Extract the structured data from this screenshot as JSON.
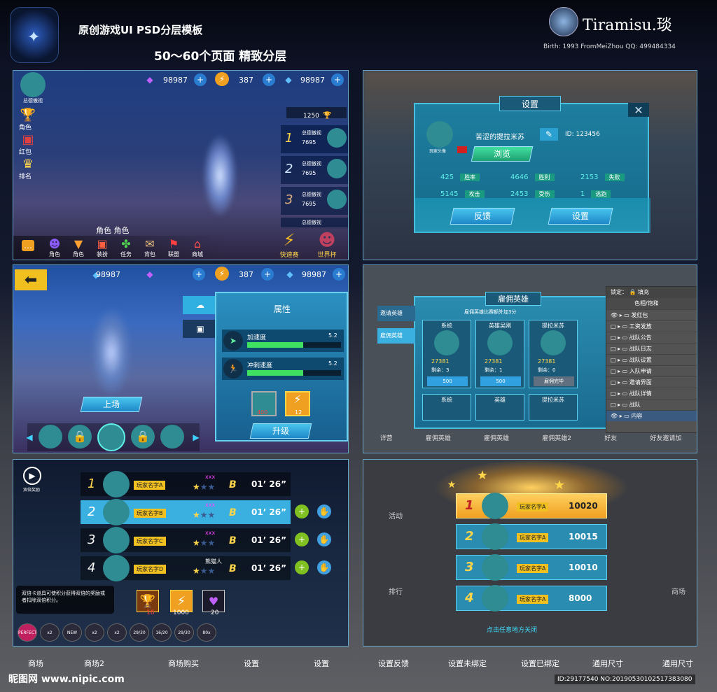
{
  "header": {
    "title": "原创游戏UI PSD分层模板",
    "subtitle": "50～60个页面 精致分层",
    "brand": "Tiramisu.琰",
    "brand_info": "Birth: 1993 FromMeiZhou QQ: 499484334"
  },
  "p1": {
    "badge_small": "总德傲视",
    "res1": "98987",
    "res2": "387",
    "res3": "98987",
    "score": "1250",
    "rank_name1": "总德傲视",
    "rank_val1": "7695",
    "rank_name2": "总德傲视",
    "rank_val2": "7695",
    "rank_name3": "总德傲视",
    "rank_val3": "7695",
    "rank_name4": "总德傲视",
    "left_labels": [
      "角色",
      "红包",
      "排名"
    ],
    "char_title": "角色 角色",
    "bottom": [
      "角色",
      "角色",
      "装扮",
      "任务",
      "背包",
      "联盟",
      "商城"
    ],
    "right_btns": [
      "快速赛",
      "世界杯"
    ],
    "nums": [
      "1",
      "2",
      "3"
    ]
  },
  "p2": {
    "title": "设置",
    "name": "苦涩的提拉米苏",
    "id": "ID: 123456",
    "avatar_lbl": "玩家头像",
    "browse": "浏览",
    "stats": [
      {
        "v": "425",
        "l": "胜率"
      },
      {
        "v": "4646",
        "l": "胜利"
      },
      {
        "v": "2153",
        "l": "失败"
      },
      {
        "v": "5145",
        "l": "攻击"
      },
      {
        "v": "2453",
        "l": "受伤"
      },
      {
        "v": "1",
        "l": "逃跑"
      }
    ],
    "feedback": "反馈",
    "settings": "设置"
  },
  "p3": {
    "res1": "98987",
    "res2": "387",
    "res3": "98987",
    "attr_title": "属性",
    "speed": "加速度",
    "speed_val": "5.2",
    "dash": "冲刺速度",
    "dash_val": "5.2",
    "cost1": "400",
    "cost2": "12",
    "upgrade": "升级",
    "deploy": "上场"
  },
  "p4": {
    "title": "雇佣英雄",
    "subtitle": "雇佣英雄比赛额外加3分",
    "tabs": [
      "邀请英雄",
      "雇佣英雄"
    ],
    "cards": [
      {
        "n": "系统",
        "v": "27381",
        "r": "剩余：3",
        "b": "500"
      },
      {
        "n": "英雄吴刚",
        "v": "27381",
        "r": "剩余：1",
        "b": "500"
      },
      {
        "n": "提拉米苏",
        "v": "27381",
        "r": "剩余：0",
        "b": "雇佣完毕"
      }
    ],
    "row2": [
      "系统",
      "英雄",
      "提拉米苏"
    ],
    "remain": "剩余",
    "layers_title": "锁定：",
    "layers_fill": "填充",
    "layers_top": "色相/饱和",
    "layers": [
      "发红包",
      "工资发放",
      "战队公告",
      "战队日志",
      "战队设置",
      "入队申请",
      "邀请界面",
      "战队详情",
      "战队",
      "内容"
    ],
    "behind": [
      "详营",
      "雇佣英雄",
      "雇佣英雄",
      "雇佣英雄2",
      "好友",
      "好友邀请加"
    ]
  },
  "p5": {
    "replay": "双倍奖励",
    "ranks": [
      {
        "n": "1",
        "name": "玩家名字A",
        "tag": "xxx",
        "time": "01’ 26”"
      },
      {
        "n": "2",
        "name": "玩家名字B",
        "tag": "xxx",
        "time": "01’ 26”"
      },
      {
        "n": "3",
        "name": "玩家名字C",
        "tag": "xxx",
        "time": "01’ 26”"
      },
      {
        "n": "4",
        "name": "玩家名字D",
        "tag": "熊猫人",
        "time": "01’ 26”"
      }
    ],
    "tip": "双倍卡道具可使积分获得双倍的奖励或者扣除双倍积分。",
    "items": [
      "16",
      "1000",
      "20"
    ],
    "buffs": [
      "PERFECT 5",
      "x2",
      "NEW",
      "x2",
      "x2",
      "29/30",
      "16/20",
      "29/30",
      "80x"
    ]
  },
  "p6": {
    "ranks": [
      {
        "n": "1",
        "name": "玩家名字A",
        "v": "10020"
      },
      {
        "n": "2",
        "name": "玩家名字A",
        "v": "10015"
      },
      {
        "n": "3",
        "name": "玩家名字A",
        "v": "10010"
      },
      {
        "n": "4",
        "name": "玩家名字A",
        "v": "8000"
      }
    ],
    "close": "点击任意地方关闭",
    "behind": [
      "活动",
      "排行",
      "商场"
    ]
  },
  "captions": [
    "商场",
    "商场2",
    "商场购买",
    "设置",
    "设置",
    "设置反馈",
    "设置未绑定",
    "设置已绑定",
    "通用尺寸",
    "通用尺寸"
  ],
  "footer": {
    "site": "昵图网 www.nipic.com",
    "id": "ID:29177540 NO:20190530102517383080"
  },
  "colors": {
    "accent": "#5ff0e8",
    "gold": "#ffd54a",
    "panel": "#1a6f8c"
  }
}
